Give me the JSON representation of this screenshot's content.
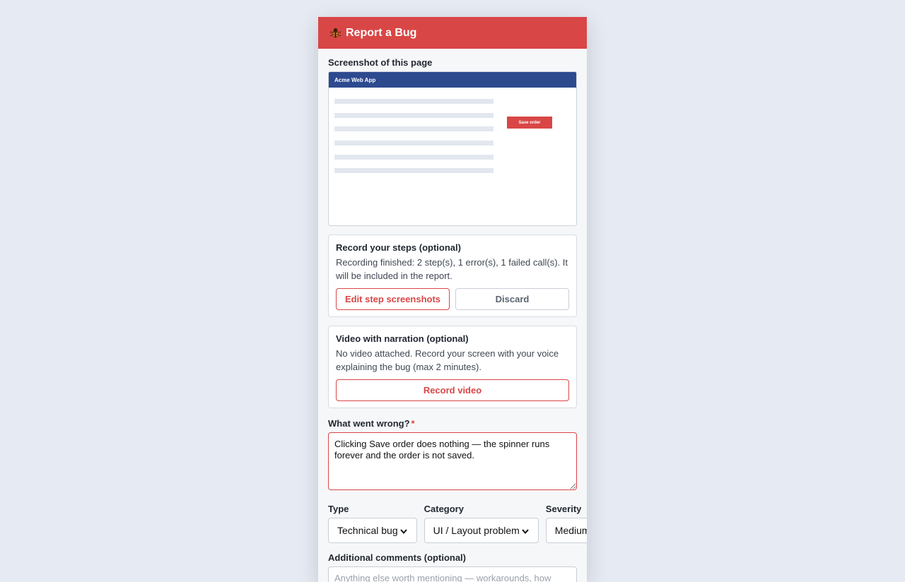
{
  "header": {
    "title": "Report a Bug",
    "icon": "bug-icon"
  },
  "screenshot": {
    "label": "Screenshot of this page",
    "app_name": "Acme Web App",
    "button_label": "Save order"
  },
  "steps": {
    "title": "Record your steps (optional)",
    "status": "Recording finished: 2 step(s), 1 error(s), 1 failed call(s). It will be included in the report.",
    "edit_label": "Edit step screenshots",
    "discard_label": "Discard"
  },
  "video": {
    "title": "Video with narration (optional)",
    "status": "No video attached. Record your screen with your voice explaining the bug (max 2 minutes).",
    "record_label": "Record video"
  },
  "description": {
    "label": "What went wrong?",
    "required_mark": "*",
    "value": "Clicking Save order does nothing — the spinner runs forever and the order is not saved."
  },
  "type": {
    "label": "Type",
    "value": "Technical bug"
  },
  "category": {
    "label": "Category",
    "value": "UI / Layout problem"
  },
  "severity": {
    "label": "Severity",
    "value": "Medium"
  },
  "comments": {
    "label": "Additional comments (optional)",
    "placeholder": "Anything else worth mentioning — workarounds, how often it happens..."
  },
  "colors": {
    "accent": "#d94646",
    "header_bg": "#d94646",
    "preview_bar": "#2e4a8f",
    "page_bg": "#e6eaf2"
  }
}
